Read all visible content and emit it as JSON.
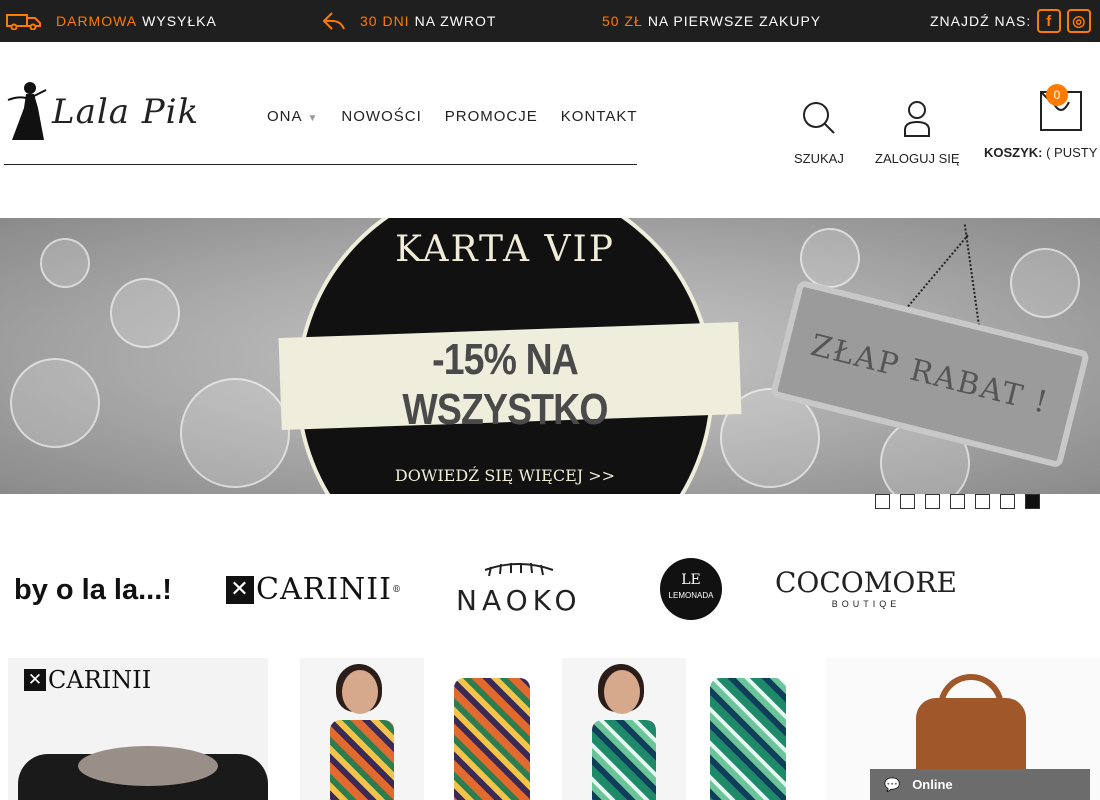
{
  "topbar": {
    "shipping": {
      "accent": "DARMOWA",
      "text": "WYSYŁKA"
    },
    "returns": {
      "accent": "30 DNI",
      "text": "NA ZWROT"
    },
    "first_purchase": {
      "accent": "50 ZŁ",
      "text": "NA PIERWSZE ZAKUPY"
    },
    "find_us": "ZNAJDŹ NAS:",
    "social": [
      {
        "icon": "facebook-icon",
        "glyph": "f"
      },
      {
        "icon": "instagram-icon",
        "glyph": "◎"
      }
    ]
  },
  "logo": {
    "text": "Lala Pik"
  },
  "nav": {
    "items": [
      "ONA",
      "NOWOŚCI",
      "PROMOCJE",
      "KONTAKT"
    ],
    "caret": "▼"
  },
  "header": {
    "search_label": "SZUKAJ",
    "login_label": "ZALOGUJ SIĘ",
    "cart_label": "KOSZYK:",
    "cart_status": " ( PUSTY )",
    "cart_count": "0"
  },
  "banner": {
    "title": "KARTA VIP",
    "discount": "-15% NA WSZYSTKO",
    "more": "DOWIEDŹ SIĘ WIĘCEJ >>",
    "tag": "ZŁAP RABAT !",
    "slides": 7,
    "active_slide": 7
  },
  "brands": {
    "olala": "by o la la...!",
    "carinii": "CARINII",
    "carinii_mark": "®",
    "naoko": "NAOKO",
    "lemonada_mark": "LE",
    "lemonada": "LEMONADA",
    "cocomore": "COCOMORE",
    "cocomore_sub": "BOUTIQE"
  },
  "tiles": {
    "carinii_logo": "CARINII"
  },
  "chat": {
    "label": "Online"
  },
  "colors": {
    "accent": "#ff7a00",
    "topbar": "#1f1f1f",
    "chat": "#6c6c6c"
  }
}
